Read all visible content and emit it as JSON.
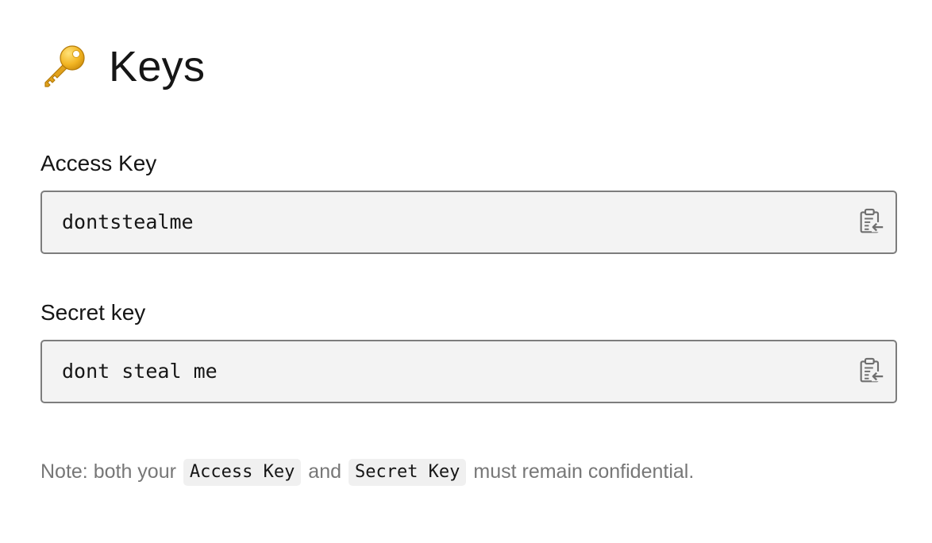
{
  "header": {
    "icon": "key-icon",
    "title": "Keys"
  },
  "access_key": {
    "label": "Access Key",
    "value": "dontstealme",
    "copy_icon": "clipboard-paste-icon"
  },
  "secret_key": {
    "label": "Secret key",
    "value": "dont steal me",
    "copy_icon": "clipboard-paste-icon"
  },
  "note": {
    "prefix": "Note: both your",
    "code1": "Access Key",
    "middle": "and",
    "code2": "Secret Key",
    "suffix": "must remain confidential."
  },
  "colors": {
    "field_background": "#f3f3f3",
    "field_border": "#7d7d7d",
    "note_text": "#777777"
  }
}
